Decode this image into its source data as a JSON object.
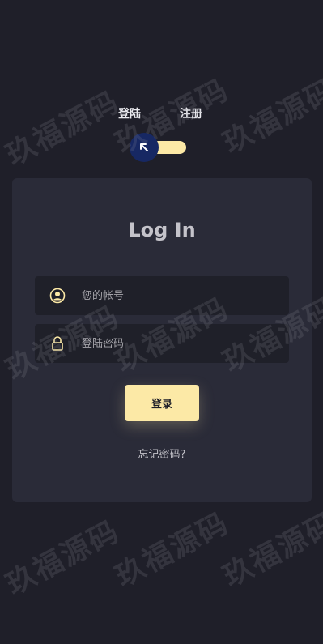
{
  "header": {
    "tab_login": "登陆",
    "tab_register": "注册"
  },
  "card": {
    "title": "Log In",
    "username_placeholder": "您的帐号",
    "password_placeholder": "登陆密码",
    "submit_label": "登录",
    "forgot_label": "忘记密码?"
  },
  "watermark": {
    "text": "玖福源码"
  },
  "colors": {
    "background": "#1f1f29",
    "card": "#2a2b38",
    "accent": "#fce9a6",
    "knob": "#172863",
    "input": "#1f2029",
    "text": "#c4c3ca"
  },
  "icons": {
    "switch": "arrow-up-left-icon",
    "username": "user-circle-icon",
    "password": "lock-icon"
  }
}
